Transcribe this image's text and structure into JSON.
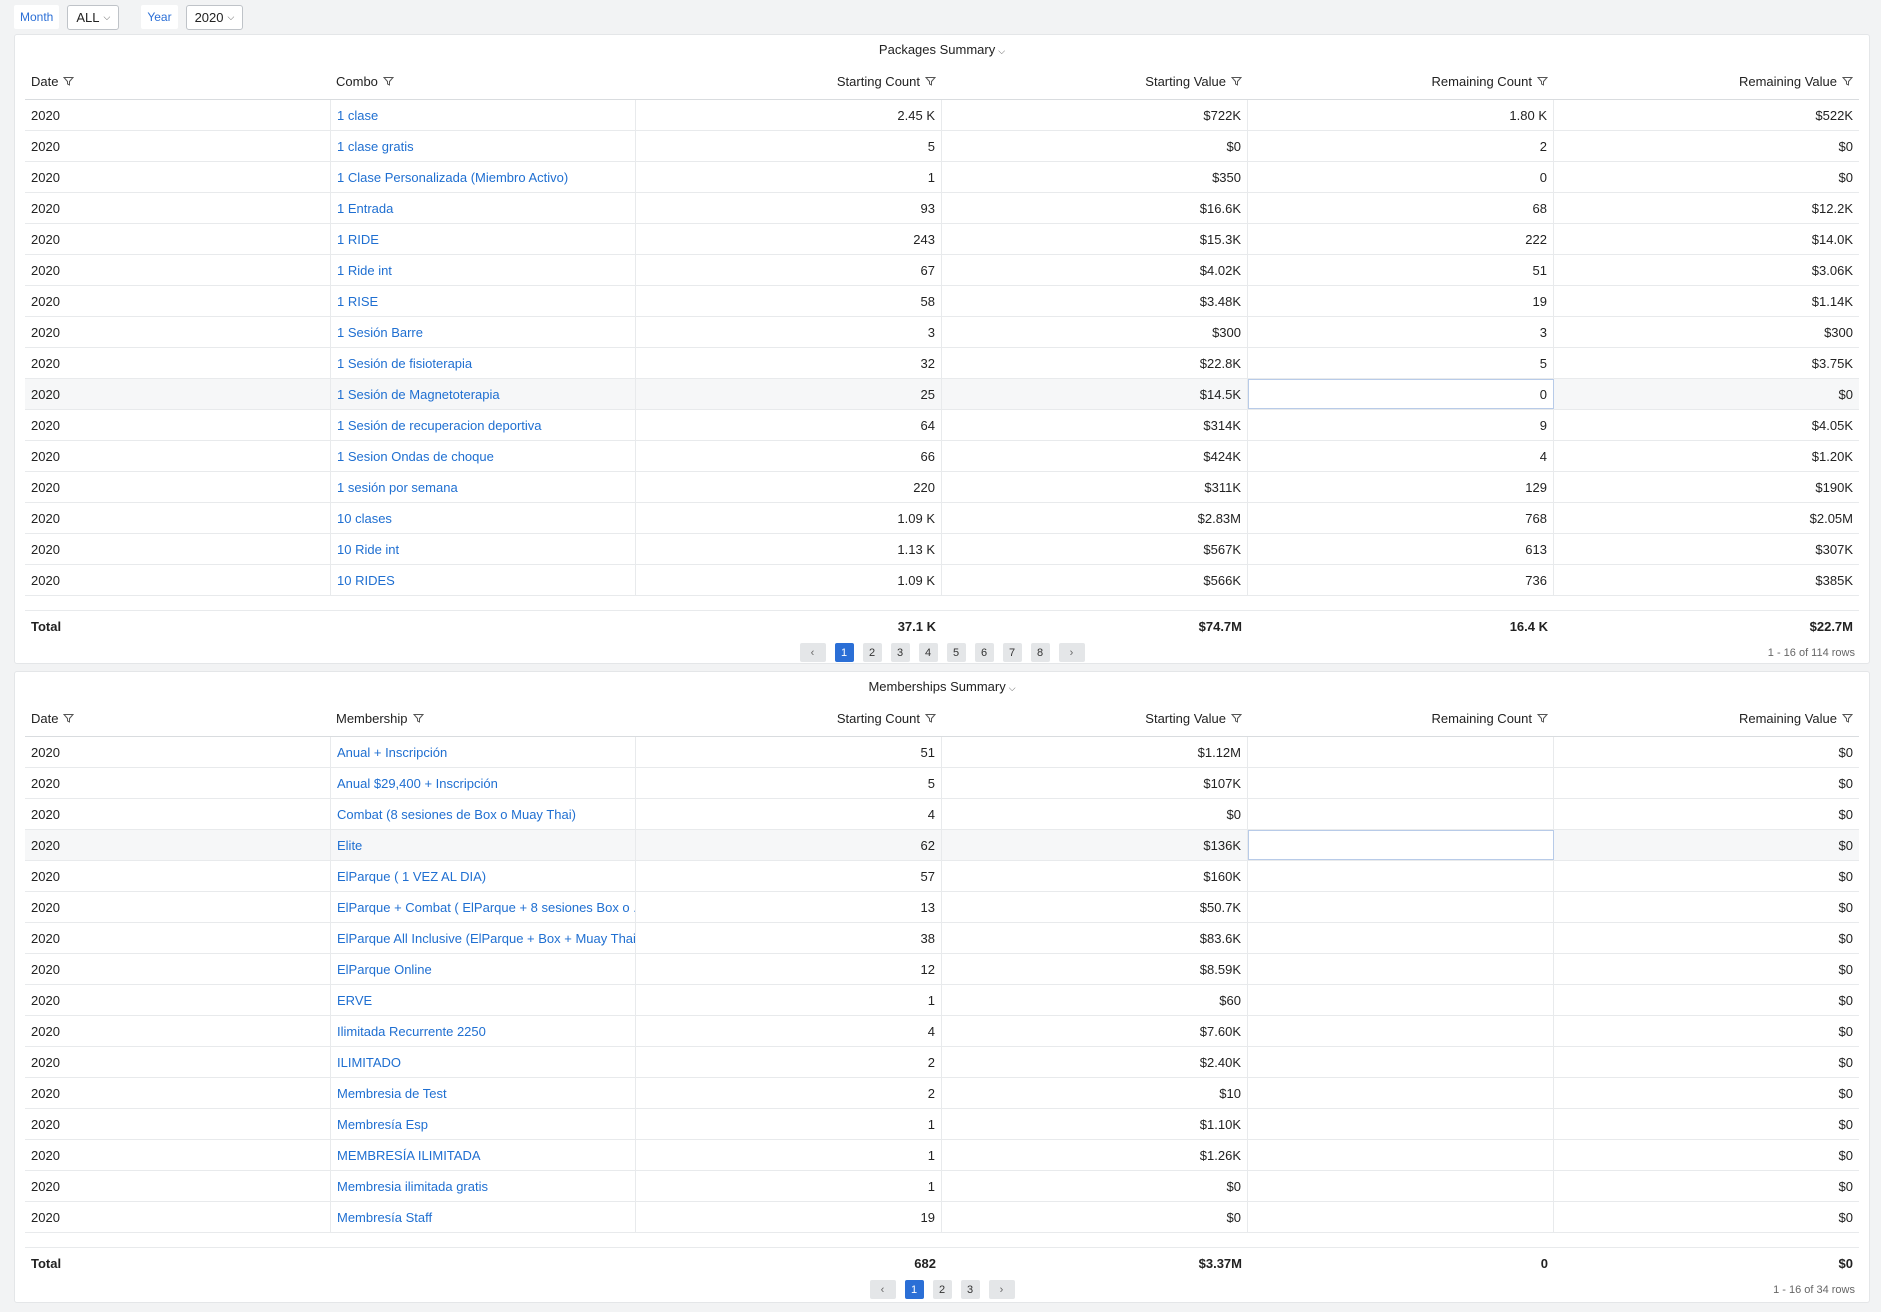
{
  "filters": {
    "month_label": "Month",
    "month_value": "ALL",
    "year_label": "Year",
    "year_value": "2020"
  },
  "packages": {
    "title": "Packages Summary",
    "columns": [
      "Date",
      "Combo",
      "Starting Count",
      "Starting Value",
      "Remaining Count",
      "Remaining Value"
    ],
    "rows": [
      [
        "2020",
        "1 clase",
        "2.45 K",
        "$722K",
        "1.80 K",
        "$522K"
      ],
      [
        "2020",
        "1 clase gratis",
        "5",
        "$0",
        "2",
        "$0"
      ],
      [
        "2020",
        "1 Clase Personalizada (Miembro Activo)",
        "1",
        "$350",
        "0",
        "$0"
      ],
      [
        "2020",
        "1 Entrada",
        "93",
        "$16.6K",
        "68",
        "$12.2K"
      ],
      [
        "2020",
        "1 RIDE",
        "243",
        "$15.3K",
        "222",
        "$14.0K"
      ],
      [
        "2020",
        "1 Ride int",
        "67",
        "$4.02K",
        "51",
        "$3.06K"
      ],
      [
        "2020",
        "1 RISE",
        "58",
        "$3.48K",
        "19",
        "$1.14K"
      ],
      [
        "2020",
        "1 Sesión Barre",
        "3",
        "$300",
        "3",
        "$300"
      ],
      [
        "2020",
        "1 Sesión de fisioterapia",
        "32",
        "$22.8K",
        "5",
        "$3.75K"
      ],
      [
        "2020",
        "1 Sesión de Magnetoterapia",
        "25",
        "$14.5K",
        "0",
        "$0"
      ],
      [
        "2020",
        "1 Sesión de recuperacion deportiva",
        "64",
        "$314K",
        "9",
        "$4.05K"
      ],
      [
        "2020",
        "1 Sesion Ondas de choque",
        "66",
        "$424K",
        "4",
        "$1.20K"
      ],
      [
        "2020",
        "1 sesión por semana",
        "220",
        "$311K",
        "129",
        "$190K"
      ],
      [
        "2020",
        "10 clases",
        "1.09 K",
        "$2.83M",
        "768",
        "$2.05M"
      ],
      [
        "2020",
        "10 Ride int",
        "1.13 K",
        "$567K",
        "613",
        "$307K"
      ],
      [
        "2020",
        "10 RIDES",
        "1.09 K",
        "$566K",
        "736",
        "$385K"
      ]
    ],
    "total": [
      "Total",
      "",
      "37.1 K",
      "$74.7M",
      "16.4 K",
      "$22.7M"
    ],
    "pages": [
      "1",
      "2",
      "3",
      "4",
      "5",
      "6",
      "7",
      "8"
    ],
    "prev": "‹",
    "next": "›",
    "rows_info": "1 - 16 of 114 rows"
  },
  "memberships": {
    "title": "Memberships Summary",
    "columns": [
      "Date",
      "Membership",
      "Starting Count",
      "Starting Value",
      "Remaining Count",
      "Remaining Value"
    ],
    "rows": [
      [
        "2020",
        "Anual + Inscripción",
        "51",
        "$1.12M",
        "",
        "$0"
      ],
      [
        "2020",
        "Anual $29,400 + Inscripción",
        "5",
        "$107K",
        "",
        "$0"
      ],
      [
        "2020",
        "Combat (8 sesiones de Box o Muay Thai)",
        "4",
        "$0",
        "",
        "$0"
      ],
      [
        "2020",
        "Elite",
        "62",
        "$136K",
        "",
        "$0"
      ],
      [
        "2020",
        "ElParque ( 1 VEZ AL DIA)",
        "57",
        "$160K",
        "",
        "$0"
      ],
      [
        "2020",
        "ElParque + Combat ( ElParque + 8 sesiones Box o ...",
        "13",
        "$50.7K",
        "",
        "$0"
      ],
      [
        "2020",
        "ElParque All Inclusive (ElParque + Box + Muay Thai)",
        "38",
        "$83.6K",
        "",
        "$0"
      ],
      [
        "2020",
        "ElParque Online",
        "12",
        "$8.59K",
        "",
        "$0"
      ],
      [
        "2020",
        "ERVE",
        "1",
        "$60",
        "",
        "$0"
      ],
      [
        "2020",
        "Ilimitada Recurrente 2250",
        "4",
        "$7.60K",
        "",
        "$0"
      ],
      [
        "2020",
        "ILIMITADO",
        "2",
        "$2.40K",
        "",
        "$0"
      ],
      [
        "2020",
        "Membresia de Test",
        "2",
        "$10",
        "",
        "$0"
      ],
      [
        "2020",
        "Membresía Esp",
        "1",
        "$1.10K",
        "",
        "$0"
      ],
      [
        "2020",
        "MEMBRESÍA ILIMITADA",
        "1",
        "$1.26K",
        "",
        "$0"
      ],
      [
        "2020",
        "Membresia ilimitada gratis",
        "1",
        "$0",
        "",
        "$0"
      ],
      [
        "2020",
        "Membresía Staff",
        "19",
        "$0",
        "",
        "$0"
      ]
    ],
    "total": [
      "Total",
      "",
      "682",
      "$3.37M",
      "0",
      "$0"
    ],
    "pages": [
      "1",
      "2",
      "3"
    ],
    "prev": "‹",
    "next": "›",
    "rows_info": "1 - 16 of 34 rows"
  },
  "icons": {
    "filter": "filter-icon",
    "dropdown": "chevron-down-icon"
  },
  "colors": {
    "link": "#1f6fd1",
    "active_page": "#2b6fd6"
  }
}
